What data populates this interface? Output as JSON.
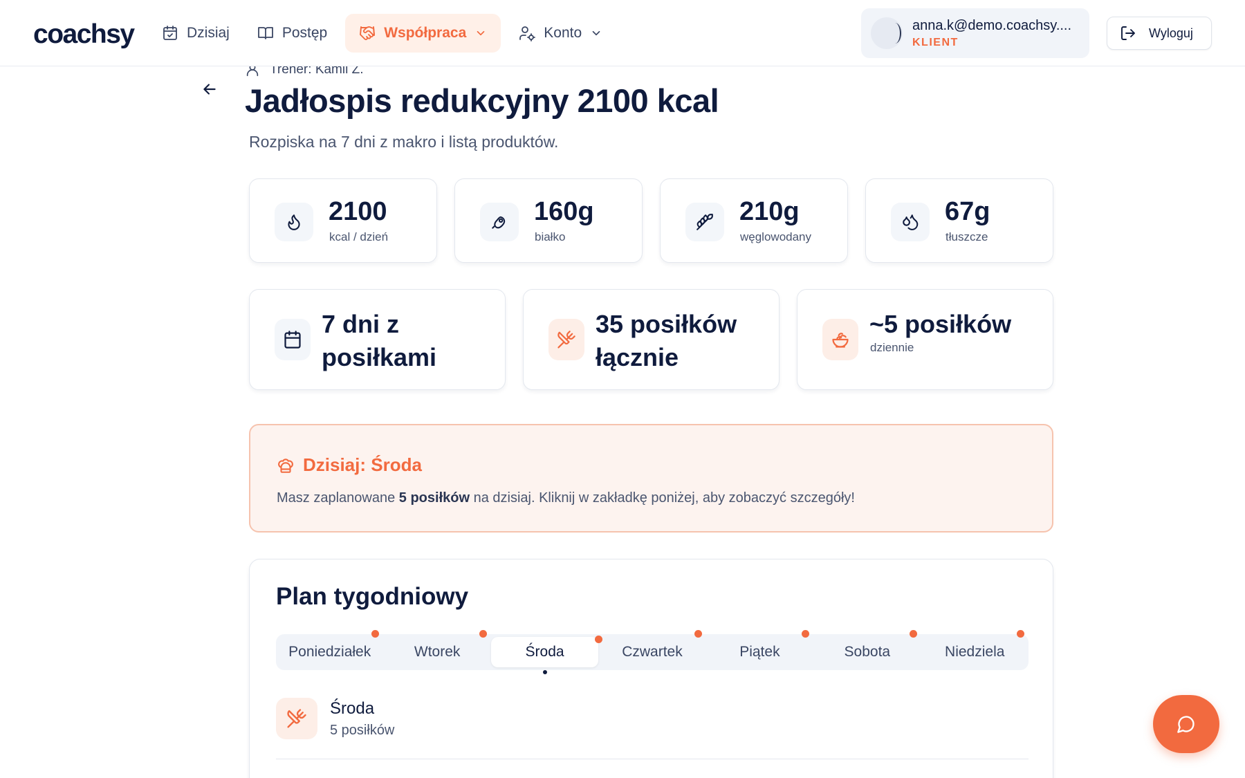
{
  "header": {
    "logo": "coachsy",
    "nav": [
      {
        "label": "Dzisiaj"
      },
      {
        "label": "Postęp"
      },
      {
        "label": "Współpraca"
      },
      {
        "label": "Konto"
      }
    ],
    "user": {
      "email": "anna.k@demo.coachsy....",
      "role": "KLIENT"
    },
    "logout_label": "Wyloguj"
  },
  "page": {
    "trainer": "Trener: Kamil Z.",
    "title": "Jadłospis redukcyjny 2100 kcal",
    "subtitle": "Rozpiska na 7 dni z makro i listą produktów."
  },
  "macros": [
    {
      "value": "2100",
      "label": "kcal / dzień",
      "icon": "flame-icon"
    },
    {
      "value": "160g",
      "label": "białko",
      "icon": "meat-icon"
    },
    {
      "value": "210g",
      "label": "węglowodany",
      "icon": "wheat-icon"
    },
    {
      "value": "67g",
      "label": "tłuszcze",
      "icon": "droplets-icon"
    }
  ],
  "summary": [
    {
      "big": "7 dni z posiłkami",
      "small": "",
      "icon": "calendar-icon"
    },
    {
      "big": "35 posiłków łącznie",
      "small": "",
      "icon": "utensils-crossed-icon"
    },
    {
      "big": "~5 posiłków",
      "small": "dziennie",
      "icon": "salad-icon"
    }
  ],
  "today": {
    "title": "Dzisiaj: Środa",
    "text_before": "Masz zaplanowane",
    "text_bold": "5 posiłków",
    "text_after": "na dzisiaj. Kliknij w zakładkę poniżej, aby zobaczyć szczegóły!"
  },
  "plan": {
    "title": "Plan tygodniowy",
    "tabs": [
      "Poniedziałek",
      "Wtorek",
      "Środa",
      "Czwartek",
      "Piątek",
      "Sobota",
      "Niedziela"
    ],
    "active_tab": "Środa",
    "selected_day": {
      "name": "Środa",
      "count": "5 posiłków"
    }
  },
  "colors": {
    "accent": "#f26a3f",
    "text": "#0f1b3d",
    "muted": "#4a556f"
  }
}
